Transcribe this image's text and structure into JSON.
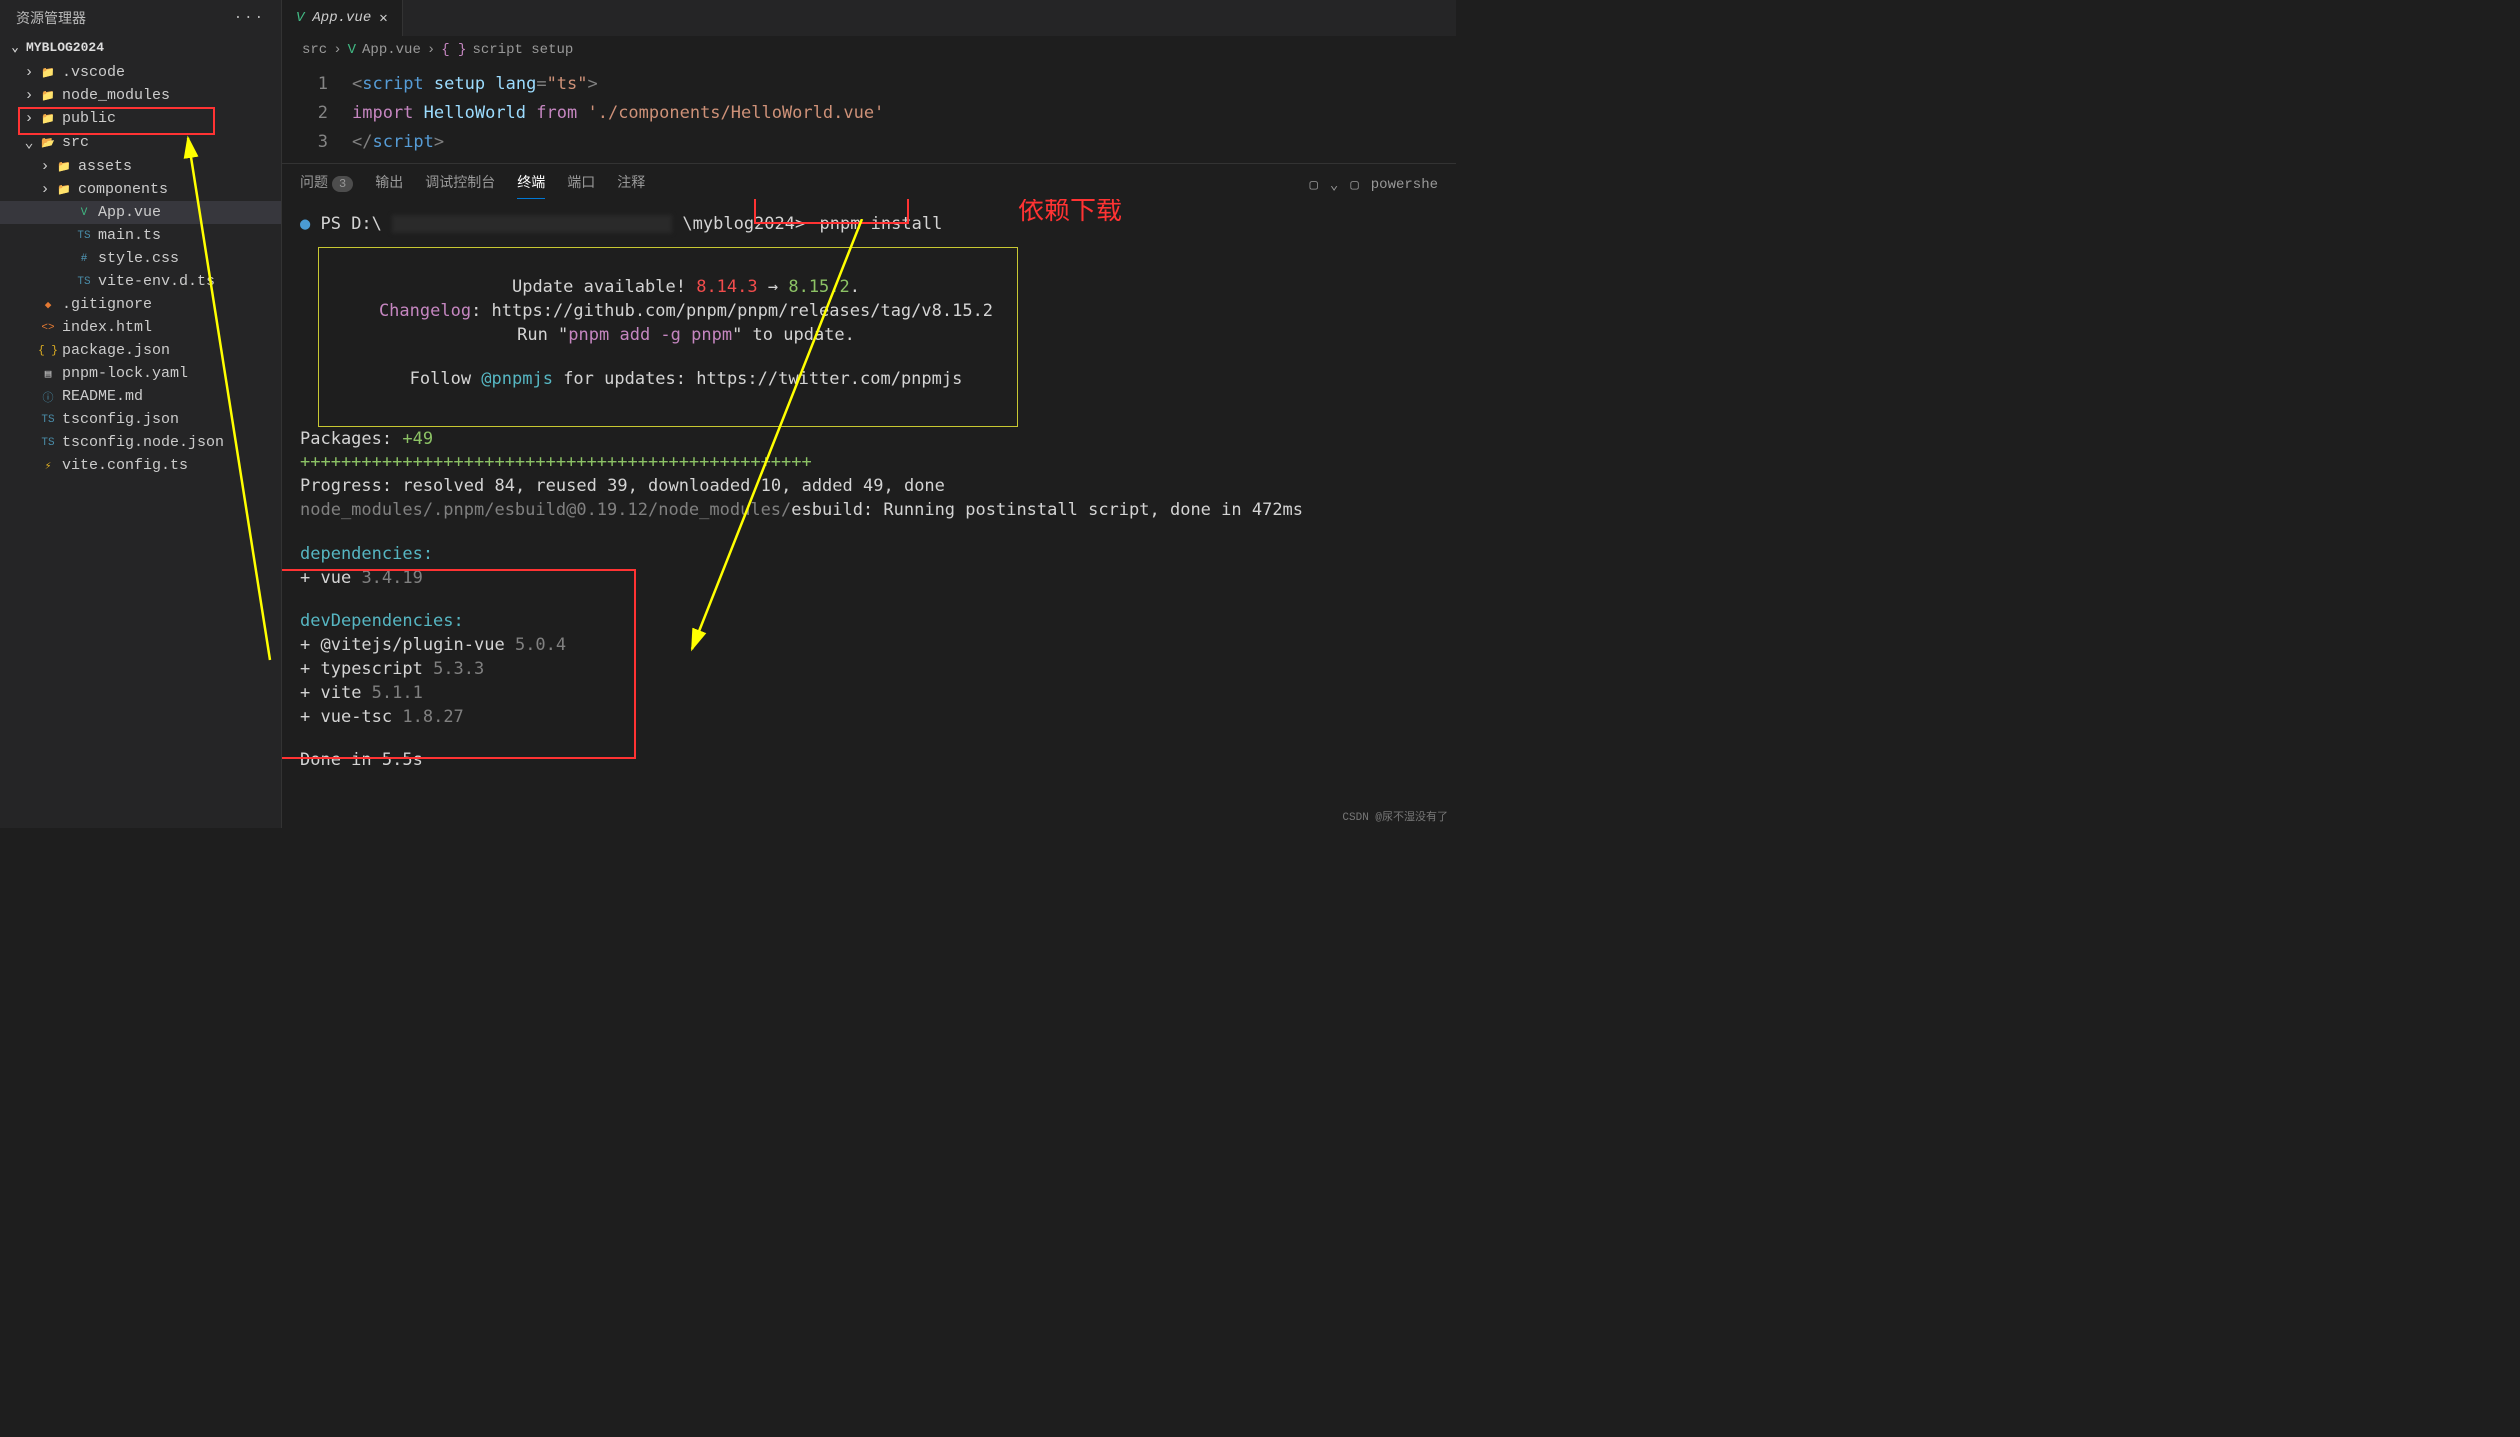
{
  "sidebar": {
    "title": "资源管理器",
    "dots": "···",
    "project": "MYBLOG2024",
    "tree": [
      {
        "label": ".vscode",
        "chev": "›",
        "depth": 0,
        "iconCls": "folder-blue",
        "glyph": "📁"
      },
      {
        "label": "node_modules",
        "chev": "›",
        "depth": 0,
        "iconCls": "folder-green",
        "glyph": "📁",
        "redbox": true
      },
      {
        "label": "public",
        "chev": "›",
        "depth": 0,
        "iconCls": "folder-blue",
        "glyph": "📁"
      },
      {
        "label": "src",
        "chev": "⌄",
        "depth": 0,
        "iconCls": "folder-green",
        "glyph": "📂"
      },
      {
        "label": "assets",
        "chev": "›",
        "depth": 1,
        "iconCls": "folder-yellow",
        "glyph": "📁"
      },
      {
        "label": "components",
        "chev": "›",
        "depth": 1,
        "iconCls": "folder-green",
        "glyph": "📁"
      },
      {
        "label": "App.vue",
        "chev": "",
        "depth": 2,
        "iconCls": "file-vue",
        "glyph": "V",
        "active": true
      },
      {
        "label": "main.ts",
        "chev": "",
        "depth": 2,
        "iconCls": "file-ts",
        "glyph": "TS"
      },
      {
        "label": "style.css",
        "chev": "",
        "depth": 2,
        "iconCls": "file-css",
        "glyph": "#"
      },
      {
        "label": "vite-env.d.ts",
        "chev": "",
        "depth": 2,
        "iconCls": "file-ts",
        "glyph": "TS"
      },
      {
        "label": ".gitignore",
        "chev": "",
        "depth": 0,
        "iconCls": "file-git",
        "glyph": "◆"
      },
      {
        "label": "index.html",
        "chev": "",
        "depth": 0,
        "iconCls": "file-html",
        "glyph": "<>"
      },
      {
        "label": "package.json",
        "chev": "",
        "depth": 0,
        "iconCls": "file-json",
        "glyph": "{ }"
      },
      {
        "label": "pnpm-lock.yaml",
        "chev": "",
        "depth": 0,
        "iconCls": "file-yaml",
        "glyph": "▤"
      },
      {
        "label": "README.md",
        "chev": "",
        "depth": 0,
        "iconCls": "file-md",
        "glyph": "ⓘ"
      },
      {
        "label": "tsconfig.json",
        "chev": "",
        "depth": 0,
        "iconCls": "file-ts",
        "glyph": "TS"
      },
      {
        "label": "tsconfig.node.json",
        "chev": "",
        "depth": 0,
        "iconCls": "file-ts",
        "glyph": "TS"
      },
      {
        "label": "vite.config.ts",
        "chev": "",
        "depth": 0,
        "iconCls": "file-json",
        "glyph": "⚡"
      }
    ]
  },
  "tab": {
    "icon": "V",
    "label": "App.vue",
    "close": "✕"
  },
  "breadcrumb": {
    "p1": "src",
    "sep": "›",
    "icon": "V",
    "p2": "App.vue",
    "brace": "{ }",
    "p3": "script setup"
  },
  "editor": {
    "lines": [
      {
        "n": "1",
        "html": "<span class='tag'>&lt;</span><span class='tagname'>script</span> <span class='attr'>setup</span> <span class='attr'>lang</span><span class='tag'>=</span><span class='str'>\"ts\"</span><span class='tag'>&gt;</span>"
      },
      {
        "n": "2",
        "html": "<span class='kw'>import</span> <span class='ident'>HelloWorld</span> <span class='kw'>from</span> <span class='str'>'./components/HelloWorld.vue'</span>"
      },
      {
        "n": "3",
        "html": "<span class='tag'>&lt;/</span><span class='tagname'>script</span><span class='tag'>&gt;</span>"
      }
    ]
  },
  "panel": {
    "tabs": {
      "problems": "问题",
      "badge": "3",
      "output": "输出",
      "debug": "调试控制台",
      "terminal": "终端",
      "ports": "端口",
      "comments": "注释"
    },
    "right": {
      "split": "▢",
      "chev": "⌄",
      "shell": "powershe"
    }
  },
  "terminal": {
    "prompt_pre": "PS D:\\",
    "prompt_mid": "\\myblog2024>",
    "cmd": "pnpm install",
    "annot": "依赖下载",
    "update_l1_a": "Update available! ",
    "update_l1_b": "8.14.3",
    "update_l1_c": " → ",
    "update_l1_d": "8.15.2",
    "update_l1_e": ".",
    "changelog_lbl": "Changelog",
    "changelog_url": ": https://github.com/pnpm/pnpm/releases/tag/v8.15.2",
    "run_a": "Run \"",
    "run_b": "pnpm add -g pnpm",
    "run_c": "\" to update.",
    "follow_a": "Follow ",
    "follow_b": "@pnpmjs",
    "follow_c": " for updates: https://twitter.com/pnpmjs",
    "pkg_lbl": "Packages: ",
    "pkg_n": "+49",
    "plusline": "++++++++++++++++++++++++++++++++++++++++++++++++++",
    "progress_a": "Progress: resolved ",
    "progress_b": "84",
    "progress_c": ", reused ",
    "progress_d": "39",
    "progress_e": ", downloaded ",
    "progress_f": "10",
    "progress_g": ", added ",
    "progress_h": "49",
    "progress_i": ", done",
    "esbuild_a": "node_modules/.pnpm/esbuild@0.19.12/node_modules/",
    "esbuild_b": "esbuild: Running postinstall script, done in 472ms",
    "deps_hdr": "dependencies:",
    "dep_plus": "+ ",
    "dep_vue": "vue ",
    "dep_vue_v": "3.4.19",
    "devdeps_hdr": "devDependencies:",
    "dep_vite_plugin": "@vitejs/plugin-vue ",
    "dep_vite_plugin_v": "5.0.4",
    "dep_ts": "typescript ",
    "dep_ts_v": "5.3.3",
    "dep_vite": "vite ",
    "dep_vite_v": "5.1.1",
    "dep_vuetsc": "vue-tsc ",
    "dep_vuetsc_v": "1.8.27",
    "done": "Done in 5.5s"
  },
  "watermark": "CSDN @尿不湿没有了"
}
